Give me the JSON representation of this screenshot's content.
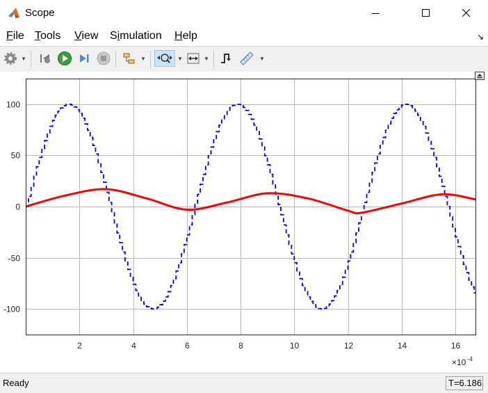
{
  "window": {
    "title": "Scope",
    "minimize_icon": "minimize-icon",
    "maximize_icon": "maximize-icon",
    "close_icon": "close-icon"
  },
  "menu": {
    "items": [
      {
        "label": "File",
        "mnemonic": "F"
      },
      {
        "label": "Tools",
        "mnemonic": "T"
      },
      {
        "label": "View",
        "mnemonic": "V"
      },
      {
        "label": "Simulation",
        "mnemonic": "i"
      },
      {
        "label": "Help",
        "mnemonic": "H"
      }
    ]
  },
  "toolbar": {
    "icons": [
      "gear-icon",
      "step-back-icon",
      "run-icon",
      "step-forward-icon",
      "stop-icon",
      "highlight-icon",
      "zoom-icon",
      "autoscale-icon",
      "trigger-icon",
      "measurement-icon"
    ]
  },
  "status": {
    "text": "Ready",
    "time": "T=6.186"
  },
  "chart_data": {
    "type": "line",
    "title": "",
    "xlabel": "",
    "ylabel": "",
    "x_exponent_label": "×10",
    "x_exponent": "-4",
    "xlim": [
      0,
      0.001675
    ],
    "ylim": [
      -125,
      125
    ],
    "x_ticks": [
      0.0002,
      0.0004,
      0.0006,
      0.0008,
      0.001,
      0.0012,
      0.0014,
      0.0016
    ],
    "x_tick_labels": [
      "2",
      "4",
      "6",
      "8",
      "10",
      "12",
      "14",
      "16"
    ],
    "y_ticks": [
      100,
      50,
      0,
      -50,
      -100
    ],
    "y_tick_labels": [
      "100",
      "50",
      "0",
      "-50",
      "-100"
    ],
    "grid": true,
    "series": [
      {
        "color": "#0000ff",
        "style": "dashed-staircase",
        "amplitude": 100,
        "period": 0.000628,
        "sample_step": 1e-05,
        "description": "sampled sine wave"
      },
      {
        "color": "#ff0000",
        "style": "solid",
        "samples": [
          [
            0,
            0
          ],
          [
            0.00015,
            11
          ],
          [
            0.0003,
            17
          ],
          [
            0.00045,
            8
          ],
          [
            0.0006,
            -3
          ],
          [
            0.00075,
            4
          ],
          [
            0.0009,
            13
          ],
          [
            0.00105,
            8
          ],
          [
            0.0012,
            -4
          ],
          [
            0.00125,
            -6
          ],
          [
            0.0014,
            3
          ],
          [
            0.00155,
            12
          ],
          [
            0.001675,
            7
          ]
        ]
      }
    ]
  }
}
